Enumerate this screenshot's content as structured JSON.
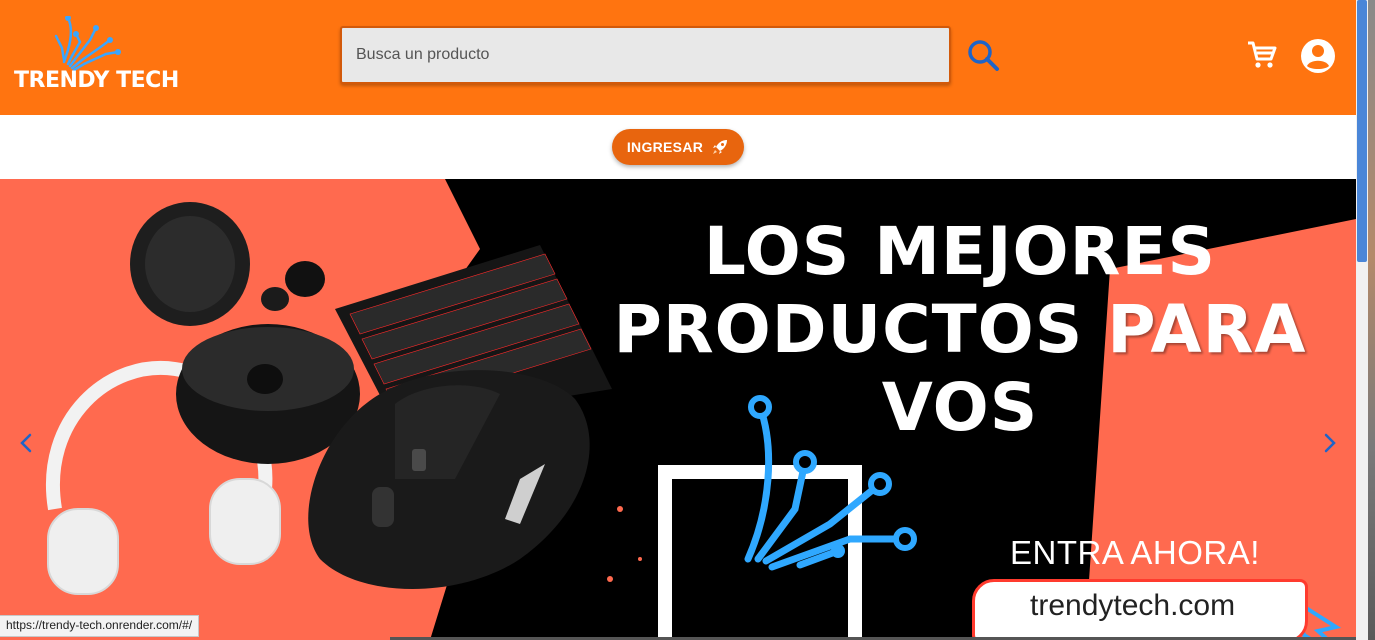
{
  "header": {
    "logo_text": "TRENDY TECH",
    "search_placeholder": "Busca un producto",
    "search_icon": "search-icon",
    "cart_icon": "cart-icon",
    "account_icon": "account-circle-icon",
    "brand_color": "#ff7410"
  },
  "login": {
    "label": "INGRESAR",
    "icon": "rocket-icon"
  },
  "carousel": {
    "headline_line1": "LOS MEJORES",
    "headline_line2": "PRODUCTOS PARA",
    "headline_line3": "VOS",
    "cta": "ENTRA AHORA!",
    "url": "trendytech.com",
    "prev_icon": "chevron-left-icon",
    "next_icon": "chevron-right-icon",
    "accent_color": "#2fa8ff"
  },
  "status_bar": {
    "url": "https://trendy-tech.onrender.com/#/"
  }
}
